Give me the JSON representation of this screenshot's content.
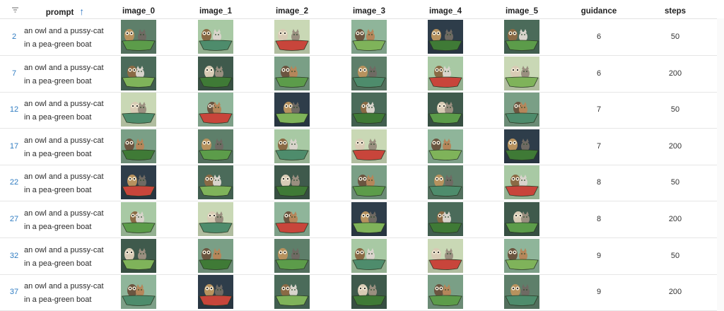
{
  "table": {
    "columns": {
      "prompt": "prompt",
      "image_0": "image_0",
      "image_1": "image_1",
      "image_2": "image_2",
      "image_3": "image_3",
      "image_4": "image_4",
      "image_5": "image_5",
      "guidance": "guidance",
      "steps": "steps"
    },
    "sort": {
      "column": "prompt",
      "direction": "ascending",
      "icon": "arrow-up-icon"
    },
    "filter_icon": "filter-icon",
    "rows": [
      {
        "index": "2",
        "prompt": "an owl and a pussy-cat in a pea-green boat",
        "guidance": "6",
        "steps": "50"
      },
      {
        "index": "7",
        "prompt": "an owl and a pussy-cat in a pea-green boat",
        "guidance": "6",
        "steps": "200"
      },
      {
        "index": "12",
        "prompt": "an owl and a pussy-cat in a pea-green boat",
        "guidance": "7",
        "steps": "50"
      },
      {
        "index": "17",
        "prompt": "an owl and a pussy-cat in a pea-green boat",
        "guidance": "7",
        "steps": "200"
      },
      {
        "index": "22",
        "prompt": "an owl and a pussy-cat in a pea-green boat",
        "guidance": "8",
        "steps": "50"
      },
      {
        "index": "27",
        "prompt": "an owl and a pussy-cat in a pea-green boat",
        "guidance": "8",
        "steps": "200"
      },
      {
        "index": "32",
        "prompt": "an owl and a pussy-cat in a pea-green boat",
        "guidance": "9",
        "steps": "50"
      },
      {
        "index": "37",
        "prompt": "an owl and a pussy-cat in a pea-green boat",
        "guidance": "9",
        "steps": "200"
      }
    ]
  },
  "palette": {
    "accent": "#2f78c4",
    "backgrounds": [
      "#5e7f6a",
      "#8fb59a",
      "#3f5a4c",
      "#a8c9a4",
      "#2e3d4a",
      "#7a9f86",
      "#c9d8b5",
      "#4b6b5a"
    ],
    "boats": [
      "#5c9c4a",
      "#3f7a36",
      "#7fb35a",
      "#c8453b",
      "#4e8c6c"
    ],
    "owls": [
      "#8a6a45",
      "#b7925e",
      "#6b5540",
      "#d8cbb5"
    ],
    "cats": [
      "#9a8f80",
      "#d9d4cc",
      "#6f6a63",
      "#b5865a"
    ]
  }
}
